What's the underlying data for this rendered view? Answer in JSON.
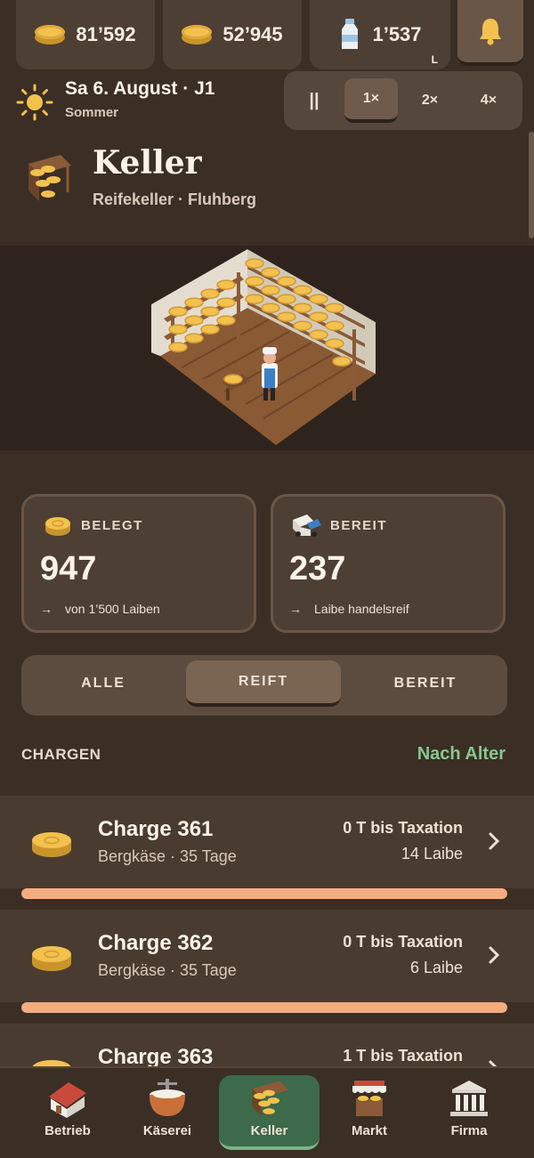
{
  "resources": [
    {
      "icon": "cheese-wheel-icon",
      "value": "81’592"
    },
    {
      "icon": "cheese-stack-icon",
      "value": "52’945"
    },
    {
      "icon": "milk-bottle-icon",
      "value": "1’537",
      "unit": "L"
    }
  ],
  "notifications": {
    "icon": "bell-icon"
  },
  "date": {
    "main": "Sa 6. August · J1",
    "season": "Sommer",
    "icon": "sun-icon"
  },
  "speed": {
    "pause": "||",
    "options": [
      "1×",
      "2×",
      "4×"
    ],
    "selected": "1×"
  },
  "header": {
    "title": "Keller",
    "subtitle": "Reifekeller · Fluhberg",
    "icon": "cheese-shelf-icon"
  },
  "stats": {
    "occupied": {
      "label": "BELEGT",
      "value": "947",
      "note": "von 1’500 Laiben",
      "icon": "cheese-wheel-icon"
    },
    "ready": {
      "label": "BEREIT",
      "value": "237",
      "note": "Laibe handelsreif",
      "icon": "delivery-truck-icon"
    }
  },
  "filters": {
    "tabs": [
      "ALLE",
      "REIFT",
      "BEREIT"
    ],
    "selected": "REIFT"
  },
  "batches_section": {
    "title": "CHARGEN",
    "sort": "Nach Alter"
  },
  "batches": [
    {
      "name": "Charge 361",
      "info": "Bergkäse · 35 Tage",
      "taxation": "0 T bis Taxation",
      "count": "14 Laibe",
      "progress": 1.0
    },
    {
      "name": "Charge 362",
      "info": "Bergkäse · 35 Tage",
      "taxation": "0 T bis Taxation",
      "count": "6 Laibe",
      "progress": 1.0
    },
    {
      "name": "Charge 363",
      "info": "",
      "taxation": "1 T bis Taxation",
      "count": "",
      "progress": null
    }
  ],
  "nav": {
    "items": [
      {
        "label": "Betrieb",
        "icon": "farmhouse-icon"
      },
      {
        "label": "Käserei",
        "icon": "cheese-kettle-icon"
      },
      {
        "label": "Keller",
        "icon": "cheese-shelf-icon"
      },
      {
        "label": "Markt",
        "icon": "market-stall-icon"
      },
      {
        "label": "Firma",
        "icon": "bank-building-icon"
      }
    ],
    "selected": "Keller"
  },
  "colors": {
    "accent_green": "#86c88e",
    "progress_fill": "#f4ad80",
    "active_nav": "#3c6a4a",
    "background": "#3b2e25"
  }
}
